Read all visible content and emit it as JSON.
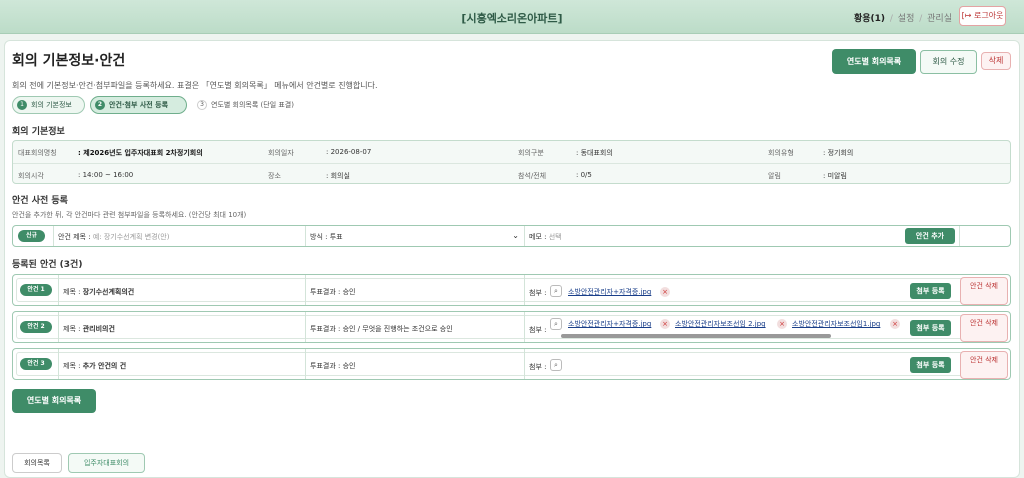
{
  "header": {
    "site_title": "[시흥엑소리온아파트]",
    "user": "황용(1)",
    "sep": "/",
    "link_settings": "설정",
    "link_admin": "관리실",
    "logout_icon": "logout-arrow-icon",
    "logout_label": "로그아웃"
  },
  "page": {
    "title": "회의 기본정보·안건",
    "description": "회의 전에 기본정보·안건·첨부파일을 등록하세요. 표결은 「연도별 회의목록」 메뉴에서 안건별로 진행합니다.",
    "btn_yearly": "연도별 회의목록",
    "btn_edit": "회의 수정",
    "btn_delete": "삭제"
  },
  "steps": [
    {
      "num": "1",
      "label": "회의 기본정보"
    },
    {
      "num": "2",
      "label": "안건·첨부 사전 등록"
    },
    {
      "num": "3",
      "label": "연도별 회의목록 (단일 표결)"
    }
  ],
  "basic": {
    "section_title": "회의 기본정보",
    "rows": [
      [
        {
          "label": "대표회의명칭",
          "value": "제2026년도 입주자대표회 2차정기회의"
        },
        {
          "label": "회의일자",
          "value": "2026-08-07"
        },
        {
          "label": "회의구분",
          "value": "동대표회의"
        },
        {
          "label": "회의유형",
          "value": "정기회의"
        }
      ],
      [
        {
          "label": "회의시각",
          "value": "14:00 ~ 16:00"
        },
        {
          "label": "장소",
          "value": "회의실"
        },
        {
          "label": "참석/전체",
          "value": "0/5"
        },
        {
          "label": "알림",
          "value": "미알림"
        }
      ]
    ]
  },
  "pre": {
    "section_title": "안건 사전 등록",
    "description": "안건을 추가한 뒤, 각 안건마다 관련 첨부파일을 등록하세요. (안건당 최대 10개)",
    "new_badge": "신규",
    "title_label": "안건 제목 :",
    "title_placeholder": "예: 장기수선계획 변경(안)",
    "method_label": "방식 :",
    "method_value": "투표",
    "memo_label": "메모 :",
    "memo_placeholder": "선택",
    "add_button": "안건 추가"
  },
  "registered": {
    "section_title": "등록된 안건 (3건)",
    "title_label": "제목 :",
    "attach_label": "첨부 :",
    "attach_button": "첨부 등록",
    "delete_button": "안건 삭제",
    "items": [
      {
        "badge": "안건 1",
        "title": "장기수선계획의건",
        "result_label": "투표결과 :",
        "result": "승인",
        "files": [
          "소방안전관리자+자격증.jpg"
        ]
      },
      {
        "badge": "안건 2",
        "title": "관리비의건",
        "result_label": "투표결과 :",
        "result": "승인 / 무엇을 진행하는 조건으로 승인",
        "files": [
          "소방안전관리자+자격증.jpg",
          "소방안전관리자보조선임 2.jpg",
          "소방안전관리자보조선임1.jpg"
        ]
      },
      {
        "badge": "안건 3",
        "title": "추가 안건의 건",
        "result_label": "투표결과 :",
        "result": "승인",
        "files": []
      }
    ]
  },
  "bottom_button": "연도별 회의목록",
  "footer": {
    "btn_list": "회의목록",
    "btn_council": "입주자대표회의"
  },
  "colors": {
    "accent": "#3f8c68",
    "danger": "#b33333",
    "header_bg": "#c6e2d0"
  }
}
